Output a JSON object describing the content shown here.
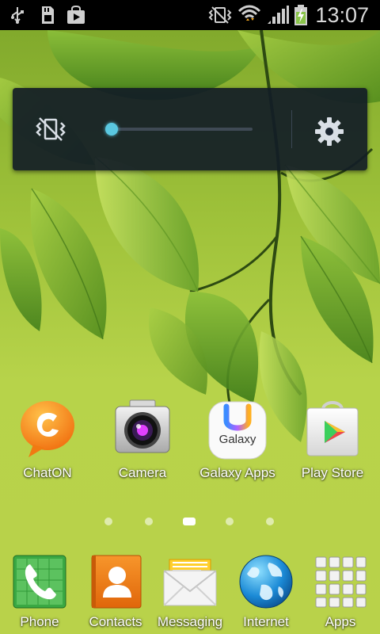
{
  "status_bar": {
    "time": "13:07",
    "left_icons": [
      "usb-icon",
      "sd-card-icon",
      "shopping-bag-icon"
    ],
    "right_icons": [
      "vibrate-icon",
      "wifi-icon",
      "signal-icon",
      "battery-charging-icon"
    ]
  },
  "volume_panel": {
    "level": 0.03,
    "mute_icon": "vibrate-mute-icon",
    "settings_icon": "gear-icon",
    "accent": "#35b9d3"
  },
  "home_apps": [
    {
      "label": "ChatON",
      "icon": "chaton-icon"
    },
    {
      "label": "Camera",
      "icon": "camera-icon"
    },
    {
      "label": "Galaxy Apps",
      "icon": "galaxy-apps-icon"
    },
    {
      "label": "Play Store",
      "icon": "play-store-icon"
    }
  ],
  "page_indicator": {
    "count": 5,
    "active": 2
  },
  "dock": [
    {
      "label": "Phone",
      "icon": "phone-icon"
    },
    {
      "label": "Contacts",
      "icon": "contacts-icon"
    },
    {
      "label": "Messaging",
      "icon": "messaging-icon"
    },
    {
      "label": "Internet",
      "icon": "globe-icon"
    },
    {
      "label": "Apps",
      "icon": "apps-grid-icon"
    }
  ]
}
